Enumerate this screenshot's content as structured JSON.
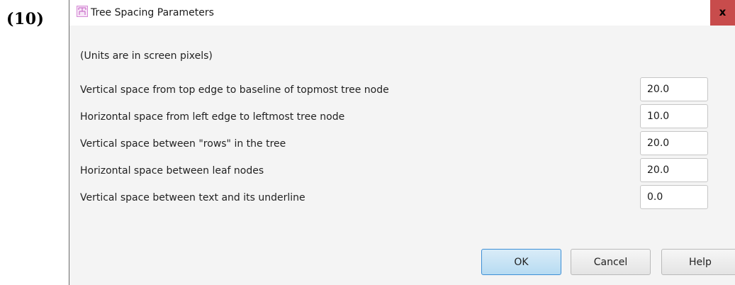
{
  "figure_label": "(10)",
  "window": {
    "title": "Tree Spacing Parameters",
    "app_icon": "tree-icon",
    "close_label": "x",
    "close_color": "#c84c4c"
  },
  "units_note": "(Units are in screen pixels)",
  "parameters": [
    {
      "label": "Vertical space from top edge to baseline of topmost tree node",
      "value": "20.0"
    },
    {
      "label": "Horizontal space from left edge to leftmost tree node",
      "value": "10.0"
    },
    {
      "label": "Vertical space between \"rows\" in the tree",
      "value": "20.0"
    },
    {
      "label": "Horizontal space between leaf nodes",
      "value": "20.0"
    },
    {
      "label": "Vertical space between text and its underline",
      "value": "0.0"
    }
  ],
  "buttons": {
    "ok_label": "OK",
    "cancel_label": "Cancel",
    "help_label": "Help",
    "ok_accent": "#3d8fd6"
  }
}
